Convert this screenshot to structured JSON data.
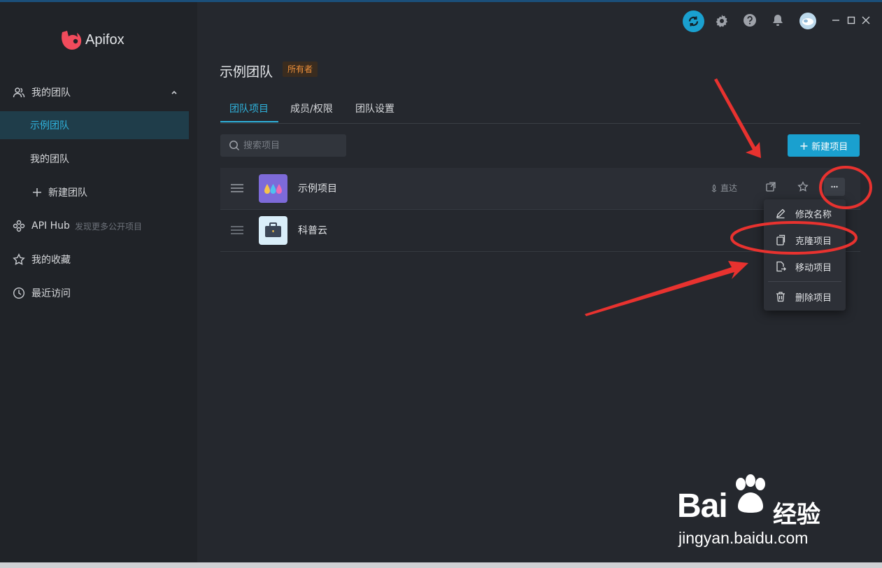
{
  "app": {
    "name": "Apifox"
  },
  "sidebar": {
    "group": "我的团队",
    "teams": [
      "示例团队",
      "我的团队"
    ],
    "new_team": "新建团队",
    "api_hub": "API Hub",
    "api_hub_hint": "发现更多公开项目",
    "favorites": "我的收藏",
    "recent": "最近访问"
  },
  "team": {
    "name": "示例团队",
    "role_badge": "所有者"
  },
  "tabs": [
    "团队项目",
    "成员/权限",
    "团队设置"
  ],
  "search": {
    "placeholder": "搜索项目"
  },
  "new_project_label": "新建项目",
  "projects": [
    {
      "name": "示例项目",
      "direct_label": "直达"
    },
    {
      "name": "科普云"
    }
  ],
  "context_menu": [
    "修改名称",
    "克隆项目",
    "移动项目",
    "删除项目"
  ],
  "watermark": {
    "brand": "Bai",
    "brand_cn": "经验",
    "url": "jingyan.baidu.com"
  },
  "colors": {
    "accent": "#1aa0cf",
    "annotation": "#e8322f",
    "badge_text": "#f0913a"
  }
}
